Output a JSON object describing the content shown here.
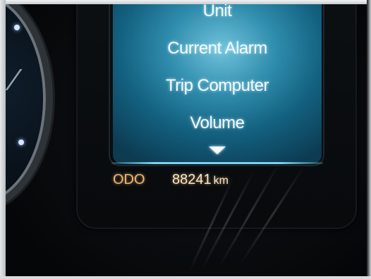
{
  "display": {
    "menu": [
      {
        "label": "Unit"
      },
      {
        "label": "Current Alarm"
      },
      {
        "label": "Trip Computer"
      },
      {
        "label": "Volume"
      }
    ],
    "scroll_indicator_icon": "triangle-down-icon"
  },
  "odometer": {
    "label": "ODO",
    "value": "88241",
    "unit": "km"
  },
  "colors": {
    "screen": "#2f8cac",
    "menu_text": "#f4fbff",
    "odo_label": "#e9b77a",
    "odo_value": "#fbe7c4"
  }
}
